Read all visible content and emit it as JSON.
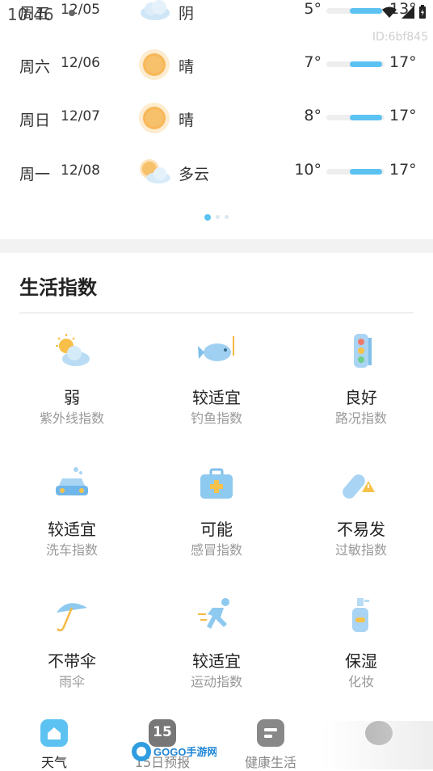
{
  "status_bar": {
    "time": "10:46",
    "device_id": "ID:6bf845"
  },
  "forecast": [
    {
      "day": "周五",
      "date": "12/05",
      "icon": "cloud-icon",
      "condition": "阴",
      "low": "5°",
      "high": "13°",
      "range": [
        0.4,
        0.96
      ]
    },
    {
      "day": "周六",
      "date": "12/06",
      "icon": "sun-icon",
      "condition": "晴",
      "low": "7°",
      "high": "17°",
      "range": [
        0.4,
        0.96
      ]
    },
    {
      "day": "周日",
      "date": "12/07",
      "icon": "sun-icon",
      "condition": "晴",
      "low": "8°",
      "high": "17°",
      "range": [
        0.4,
        0.96
      ]
    },
    {
      "day": "周一",
      "date": "12/08",
      "icon": "partly-cloudy-icon",
      "condition": "多云",
      "low": "10°",
      "high": "17°",
      "range": [
        0.4,
        0.96
      ]
    }
  ],
  "life": {
    "title": "生活指数",
    "items": [
      {
        "value": "弱",
        "label": "紫外线指数",
        "icon": "uv-sun-cloud-icon"
      },
      {
        "value": "较适宜",
        "label": "钓鱼指数",
        "icon": "fish-icon"
      },
      {
        "value": "良好",
        "label": "路况指数",
        "icon": "traffic-light-icon"
      },
      {
        "value": "较适宜",
        "label": "洗车指数",
        "icon": "car-wash-icon"
      },
      {
        "value": "可能",
        "label": "感冒指数",
        "icon": "medical-kit-icon"
      },
      {
        "value": "不易发",
        "label": "过敏指数",
        "icon": "pill-warning-icon"
      },
      {
        "value": "不带伞",
        "label": "雨伞",
        "icon": "umbrella-icon"
      },
      {
        "value": "较适宜",
        "label": "运动指数",
        "icon": "runner-icon"
      },
      {
        "value": "保湿",
        "label": "化妆",
        "icon": "spray-bottle-icon"
      }
    ]
  },
  "nav": {
    "tabs": [
      {
        "label": "天气",
        "icon": "home-icon"
      },
      {
        "label": "15日预报",
        "icon": "calendar-15-icon",
        "badge": "15"
      },
      {
        "label": "健康生活",
        "icon": "health-card-icon"
      }
    ],
    "watermark": "GOGO手游网"
  },
  "colors": {
    "accent": "#5cc2f2",
    "muted": "#999999",
    "band": "#f2f2f2"
  }
}
